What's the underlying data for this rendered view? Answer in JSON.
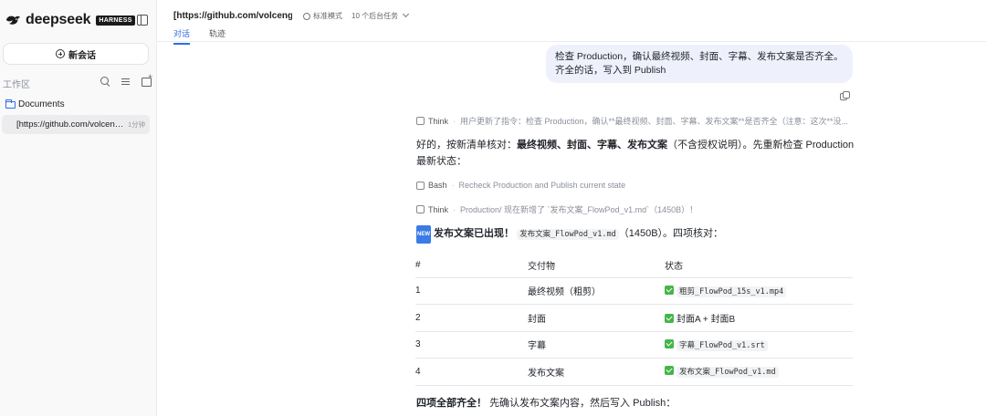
{
  "sidebar": {
    "brand": "deepseek",
    "badge": "HARNESS",
    "new_chat": "新会话",
    "workspace_label": "工作区",
    "folder": "Documents",
    "session": {
      "title": "[https://github.com/volcengine...",
      "time": "1分钟"
    }
  },
  "header": {
    "title": "[https://github.com/volcengi...",
    "mode": "标准模式",
    "tasks": "10 个后台任务",
    "tabs": [
      "对话",
      "轨迹"
    ]
  },
  "chat": {
    "user_message": "检查 Production，确认最终视频、封面、字幕、发布文案是否齐全。齐全的话，写入到 Publish",
    "steps": [
      {
        "type": "Think",
        "detail": "用户更新了指令：检查 Production，确认**最终视频、封面、字幕、发布文案**是否齐全（注意：这次**没..."
      },
      {
        "type": "Bash",
        "detail": "Recheck Production and Publish current state"
      },
      {
        "type": "Think",
        "detail": "Production/ 现在新增了 `发布文案_FlowPod_v1.md`（1450B）！"
      }
    ],
    "para1_prefix": "好的，按新清单核对：",
    "para1_bold": "最终视频、封面、字幕、发布文案",
    "para1_suffix": "（不含授权说明）。先重新检查 Production 最新状态：",
    "new_badge": "NEW",
    "para2_bold": "发布文案已出现！",
    "para2_code": "发布文案_FlowPod_v1.md",
    "para2_suffix": "（1450B）。四项核对：",
    "table": {
      "headers": [
        "#",
        "交付物",
        "状态"
      ],
      "rows": [
        {
          "num": "1",
          "item": "最终视频（粗剪）",
          "status": "粗剪_FlowPod_15s_v1.mp4",
          "code": true
        },
        {
          "num": "2",
          "item": "封面",
          "status": "封面A + 封面B",
          "code": false
        },
        {
          "num": "3",
          "item": "字幕",
          "status": "字幕_FlowPod_v1.srt",
          "code": true
        },
        {
          "num": "4",
          "item": "发布文案",
          "status": "发布文案_FlowPod_v1.md",
          "code": true
        }
      ]
    },
    "para3_bold": "四项全部齐全！",
    "para3_suffix": "先确认发布文案内容，然后写入 Publish："
  },
  "colors": {
    "accent": "#2f6ee5",
    "bubble": "#eef1fc",
    "check": "#45b549"
  }
}
